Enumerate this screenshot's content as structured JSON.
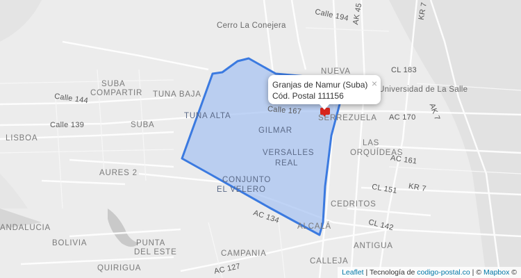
{
  "map": {
    "labels": {
      "cerro": "Cerro La Conejera",
      "calle194": "Calle 194",
      "ak45": "AK 45",
      "kr7": "KR 7",
      "nueva": "NUEVA",
      "cl183": "CL 183",
      "universidad": "Universidad de La Salle",
      "suba": "SUBA",
      "compartir": "COMPARTIR",
      "tunabaja": "TUNA BAJA",
      "calle144": "Calle 144",
      "tunaalta": "TUNA ALTA",
      "calle167": "Calle 167",
      "serrezuela": "SERREZUELA",
      "ac170": "AC 170",
      "ak7": "AK 7",
      "calle139": "Calle 139",
      "suba2": "SUBA",
      "gilmar": "GILMAR",
      "lisboa": "LISBOA",
      "las": "LAS",
      "orquideas": "ORQUÍDEAS",
      "versalles": "VERSALLES",
      "real": "REAL",
      "ac161": "AC 161",
      "aures": "AURES 2",
      "conjunto": "CONJUNTO",
      "velero": "EL VELERO",
      "cl151": "CL 151",
      "kr7b": "KR 7",
      "cedritos": "CEDRITOS",
      "ac134": "AC 134",
      "andalucia": "ANDALUCIA",
      "alcala": "ALCALÁ",
      "cl142": "CL 142",
      "bolivia": "BOLIVIA",
      "punta": "PUNTA",
      "deleste": "DEL ESTE",
      "antigua": "ANTIGUA",
      "campania": "CAMPANIA",
      "quirigua": "QUIRIGUA",
      "calleja": "CALLEJA",
      "ac127": "AC 127"
    },
    "polygon_color": "#3b7ae0",
    "polygon_fill": "#a9c4f2",
    "marker_color": "#d7261e"
  },
  "popup": {
    "line1": "Granjas de Namur (Suba)",
    "line2": "Cód. Postal 111156",
    "close": "×"
  },
  "attribution": {
    "leaflet": "Leaflet",
    "sep1": " | Tecnología de ",
    "site": "codigo-postal.co",
    "sep2": " | © ",
    "mapbox": "Mapbox",
    "copy": " ©"
  }
}
